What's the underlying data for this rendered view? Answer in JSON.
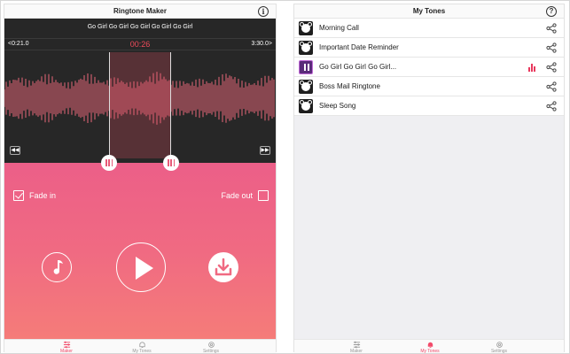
{
  "left_panel": {
    "title": "Ringtone Maker",
    "song_name": "Go Girl Go Girl Go Girl Go Girl Go Girl",
    "time_start": "<0:21.0",
    "time_current": "00:26",
    "time_end": "3:30.0>",
    "fade_in": {
      "label": "Fade in",
      "checked": true
    },
    "fade_out": {
      "label": "Fade out",
      "checked": false
    }
  },
  "tabbar_left": {
    "tabs": [
      {
        "label": "Maker",
        "active": true
      },
      {
        "label": "My Tones",
        "active": false
      },
      {
        "label": "Settings",
        "active": false
      }
    ]
  },
  "right_panel": {
    "title": "My Tones",
    "tones": [
      {
        "name": "Morning Call",
        "selected": false
      },
      {
        "name": "Important Date Reminder",
        "selected": false
      },
      {
        "name": "Go Girl Go Girl Go Girl...",
        "selected": true
      },
      {
        "name": "Boss Mail Ringtone",
        "selected": false
      },
      {
        "name": "Sleep Song",
        "selected": false
      }
    ]
  },
  "tabbar_right": {
    "tabs": [
      {
        "label": "Maker",
        "active": false
      },
      {
        "label": "My Tones",
        "active": true
      },
      {
        "label": "Settings",
        "active": false
      }
    ]
  },
  "colors": {
    "accent": "#f24a6a",
    "waveform": "#e8677a",
    "gradient_top": "#ec5f88",
    "gradient_bottom": "#f57c79",
    "editor_bg": "#272727"
  },
  "icons": {
    "info": "info-icon",
    "help": "help-icon",
    "share": "share-icon",
    "music": "music-note-icon",
    "play": "play-icon",
    "download": "download-icon",
    "rewind": "rewind-icon",
    "fast_forward": "fast-forward-icon"
  }
}
